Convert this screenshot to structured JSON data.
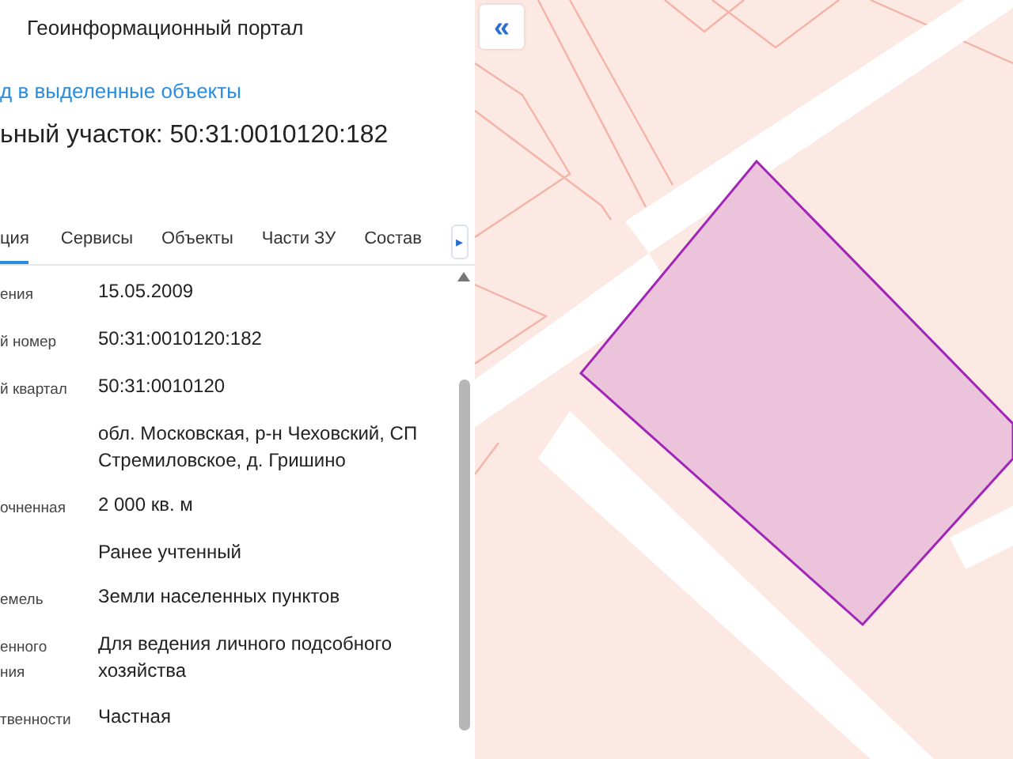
{
  "header": {
    "title": "Геоинформационный портал"
  },
  "link": "д в выделенные объекты",
  "heading": "ьный участок: 50:31:0010120:182",
  "tabs": [
    {
      "label": "ция",
      "selected": true
    },
    {
      "label": "Сервисы",
      "selected": false
    },
    {
      "label": "Объекты",
      "selected": false
    },
    {
      "label": "Части ЗУ",
      "selected": false
    },
    {
      "label": "Состав",
      "selected": false
    }
  ],
  "tabs_next": "▸",
  "rows": [
    {
      "label": [
        "ения"
      ],
      "value": "15.05.2009"
    },
    {
      "label": [
        "й номер"
      ],
      "value": "50:31:0010120:182"
    },
    {
      "label": [
        "й квартал"
      ],
      "value": "50:31:0010120"
    },
    {
      "label": [],
      "value": "обл. Московская, р-н Чеховский, СП Стремиловское, д. Гришино"
    },
    {
      "label": [
        "очненная"
      ],
      "value": "2 000 кв. м"
    },
    {
      "label": [],
      "value": "Ранее учтенный"
    },
    {
      "label": [
        "емель"
      ],
      "value": "Земли населенных пунктов"
    },
    {
      "label": [
        "енного",
        "ния"
      ],
      "value": "Для ведения личного подсобного хозяйства"
    },
    {
      "label": [
        "твенности"
      ],
      "value": "Частная"
    }
  ],
  "map": {
    "collapse": "«"
  }
}
